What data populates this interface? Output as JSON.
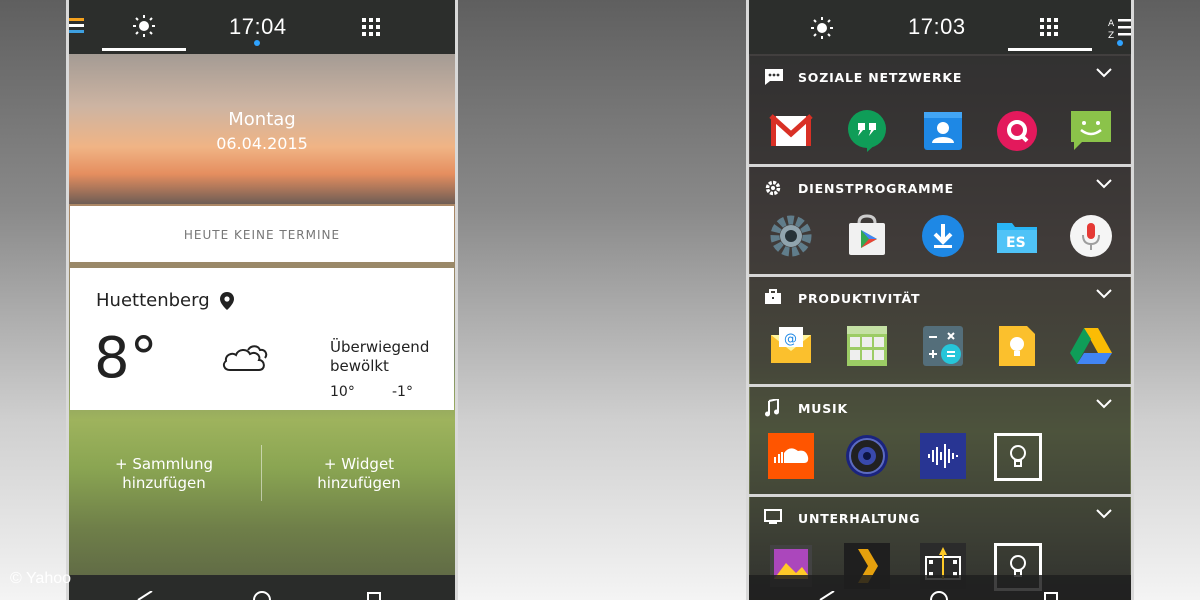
{
  "left_screen": {
    "status_time": "17:04",
    "hero": {
      "day": "Montag",
      "date": "06.04.2015"
    },
    "events_text": "HEUTE KEINE TERMINE",
    "weather": {
      "city": "Huettenberg",
      "temperature": "8°",
      "condition_line1": "Überwiegend",
      "condition_line2": "bewölkt",
      "high": "10°",
      "low": "-1°"
    },
    "add_collection_line1": "+ Sammlung",
    "add_collection_line2": "hinzufügen",
    "add_widget_line1": "+ Widget",
    "add_widget_line2": "hinzufügen"
  },
  "right_screen": {
    "status_time": "17:03",
    "sort_label": "A-Z",
    "sections": [
      {
        "label": "SOZIALE NETZWERKE",
        "icon": "chat-icon",
        "apps": [
          "gmail-icon",
          "hangouts-icon",
          "contacts-icon",
          "quik-icon",
          "messaging-icon"
        ]
      },
      {
        "label": "DIENSTPROGRAMME",
        "icon": "gear-icon",
        "apps": [
          "settings-icon",
          "play-store-icon",
          "download-icon",
          "es-file-explorer-icon",
          "voice-search-icon"
        ]
      },
      {
        "label": "PRODUKTIVITÄT",
        "icon": "briefcase-icon",
        "apps": [
          "email-icon",
          "gallery-grid-icon",
          "calculator-icon",
          "keep-icon",
          "drive-icon"
        ]
      },
      {
        "label": "MUSIK",
        "icon": "music-note-icon",
        "apps": [
          "soundcloud-icon",
          "speaker-icon",
          "audio-wave-icon",
          "add-app-icon"
        ]
      },
      {
        "label": "UNTERHALTUNG",
        "icon": "monitor-icon",
        "apps": [
          "photo-icon",
          "plex-icon",
          "video-editor-icon",
          "add-app-icon"
        ]
      }
    ]
  },
  "watermark": "© Yahoo",
  "colors": {
    "accent_blue": "#2fa3ff",
    "statusbar": "#2c2e2c"
  }
}
